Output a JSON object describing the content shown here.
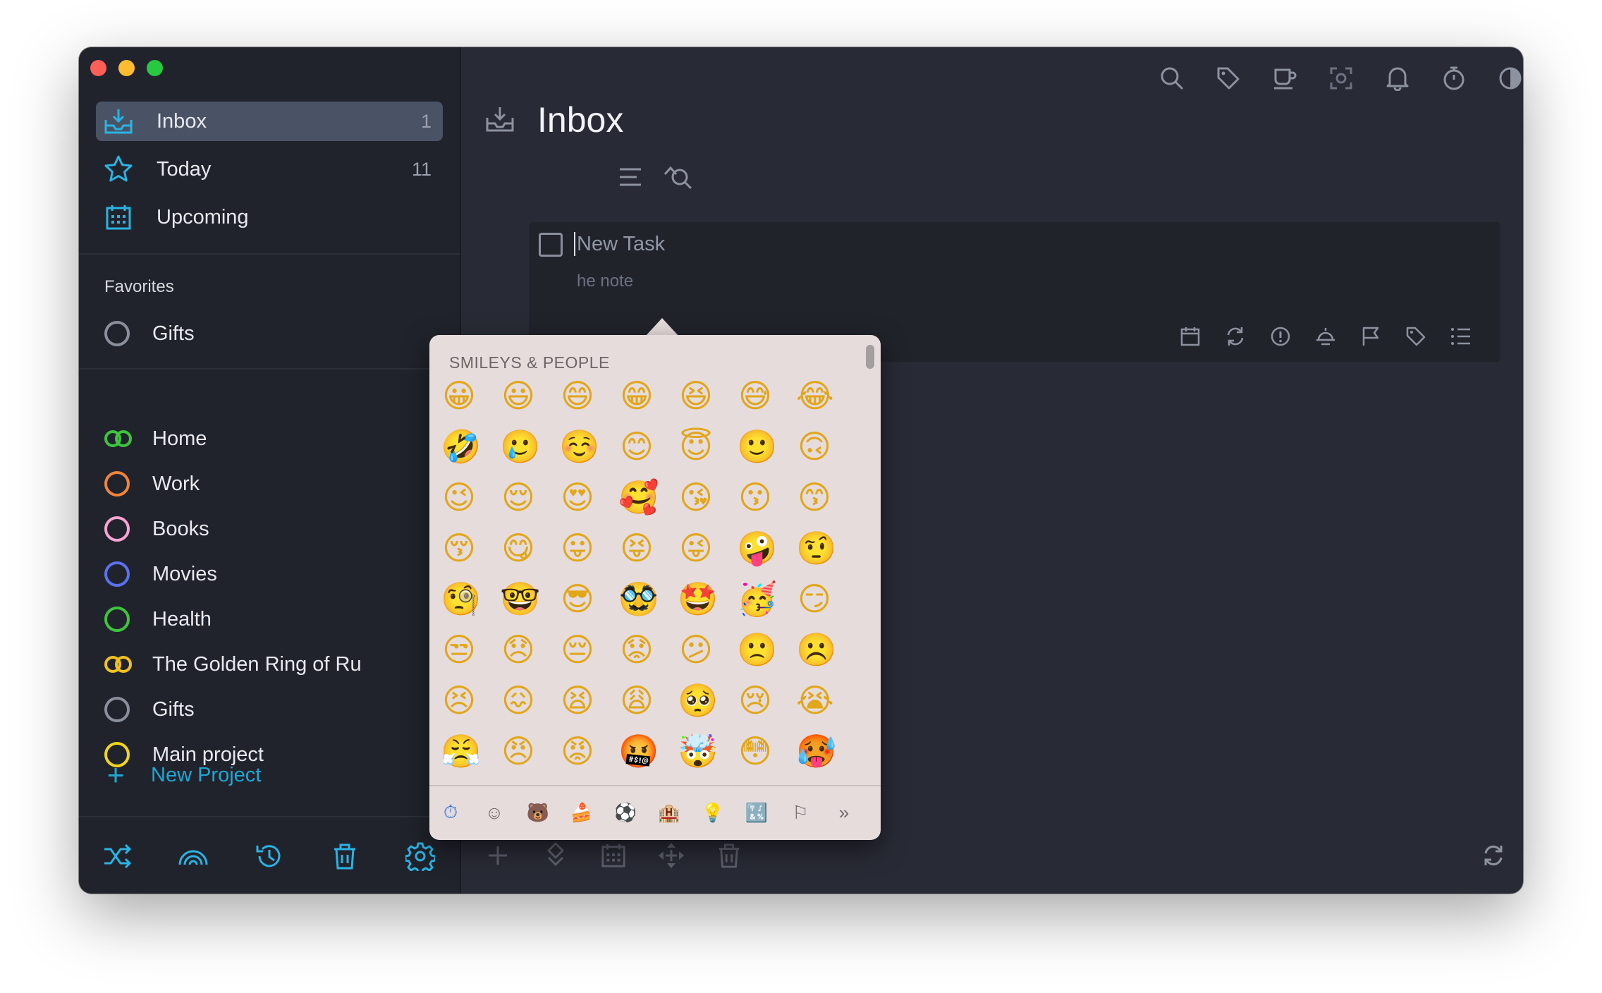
{
  "sidebar": {
    "nav": [
      {
        "label": "Inbox",
        "count": "1",
        "icon": "inbox-icon"
      },
      {
        "label": "Today",
        "count": "11",
        "icon": "star-icon"
      },
      {
        "label": "Upcoming",
        "count": "",
        "icon": "calendar-icon"
      }
    ],
    "favorites_title": "Favorites",
    "favorites": [
      {
        "label": "Gifts"
      }
    ],
    "projects": [
      {
        "label": "Home",
        "color": "#3ec43e",
        "style": "double"
      },
      {
        "label": "Work",
        "color": "#f0843a",
        "style": "ring"
      },
      {
        "label": "Books",
        "color": "#f7a3d4",
        "style": "ring"
      },
      {
        "label": "Movies",
        "color": "#5a72f0",
        "style": "ring"
      },
      {
        "label": "Health",
        "color": "#3ec43e",
        "style": "ring"
      },
      {
        "label": "The Golden Ring of Ru",
        "color": "#f0c21d",
        "style": "double"
      },
      {
        "label": "Gifts",
        "color": "#8a8f9c",
        "style": "ring"
      },
      {
        "label": "Main project",
        "color": "#f0d51d",
        "style": "ring"
      }
    ],
    "new_project": "New Project"
  },
  "main": {
    "title": "Inbox",
    "task_placeholder": "New Task",
    "note_placeholder": "he note"
  },
  "emoji_picker": {
    "title": "SMILEYS & PEOPLE",
    "rows": [
      [
        "😀",
        "😃",
        "😄",
        "😁",
        "😆",
        "😅",
        "😂"
      ],
      [
        "🤣",
        "🥲",
        "☺️",
        "😊",
        "😇",
        "🙂",
        "🙃"
      ],
      [
        "😉",
        "😌",
        "😍",
        "🥰",
        "😘",
        "😗",
        "😙"
      ],
      [
        "😚",
        "😋",
        "😛",
        "😝",
        "😜",
        "🤪",
        "🤨"
      ],
      [
        "🧐",
        "🤓",
        "😎",
        "🥸",
        "🤩",
        "🥳",
        "😏"
      ],
      [
        "😒",
        "😞",
        "😔",
        "😟",
        "😕",
        "🙁",
        "☹️"
      ],
      [
        "😣",
        "😖",
        "😫",
        "😩",
        "🥺",
        "😢",
        "😭"
      ],
      [
        "😤",
        "😠",
        "😡",
        "🤬",
        "🤯",
        "😳",
        "🥵"
      ]
    ],
    "categories": [
      "⏱",
      "☺",
      "🐻",
      "🍰",
      "⚽",
      "🏨",
      "💡",
      "🔣",
      "⚐",
      "»"
    ]
  }
}
